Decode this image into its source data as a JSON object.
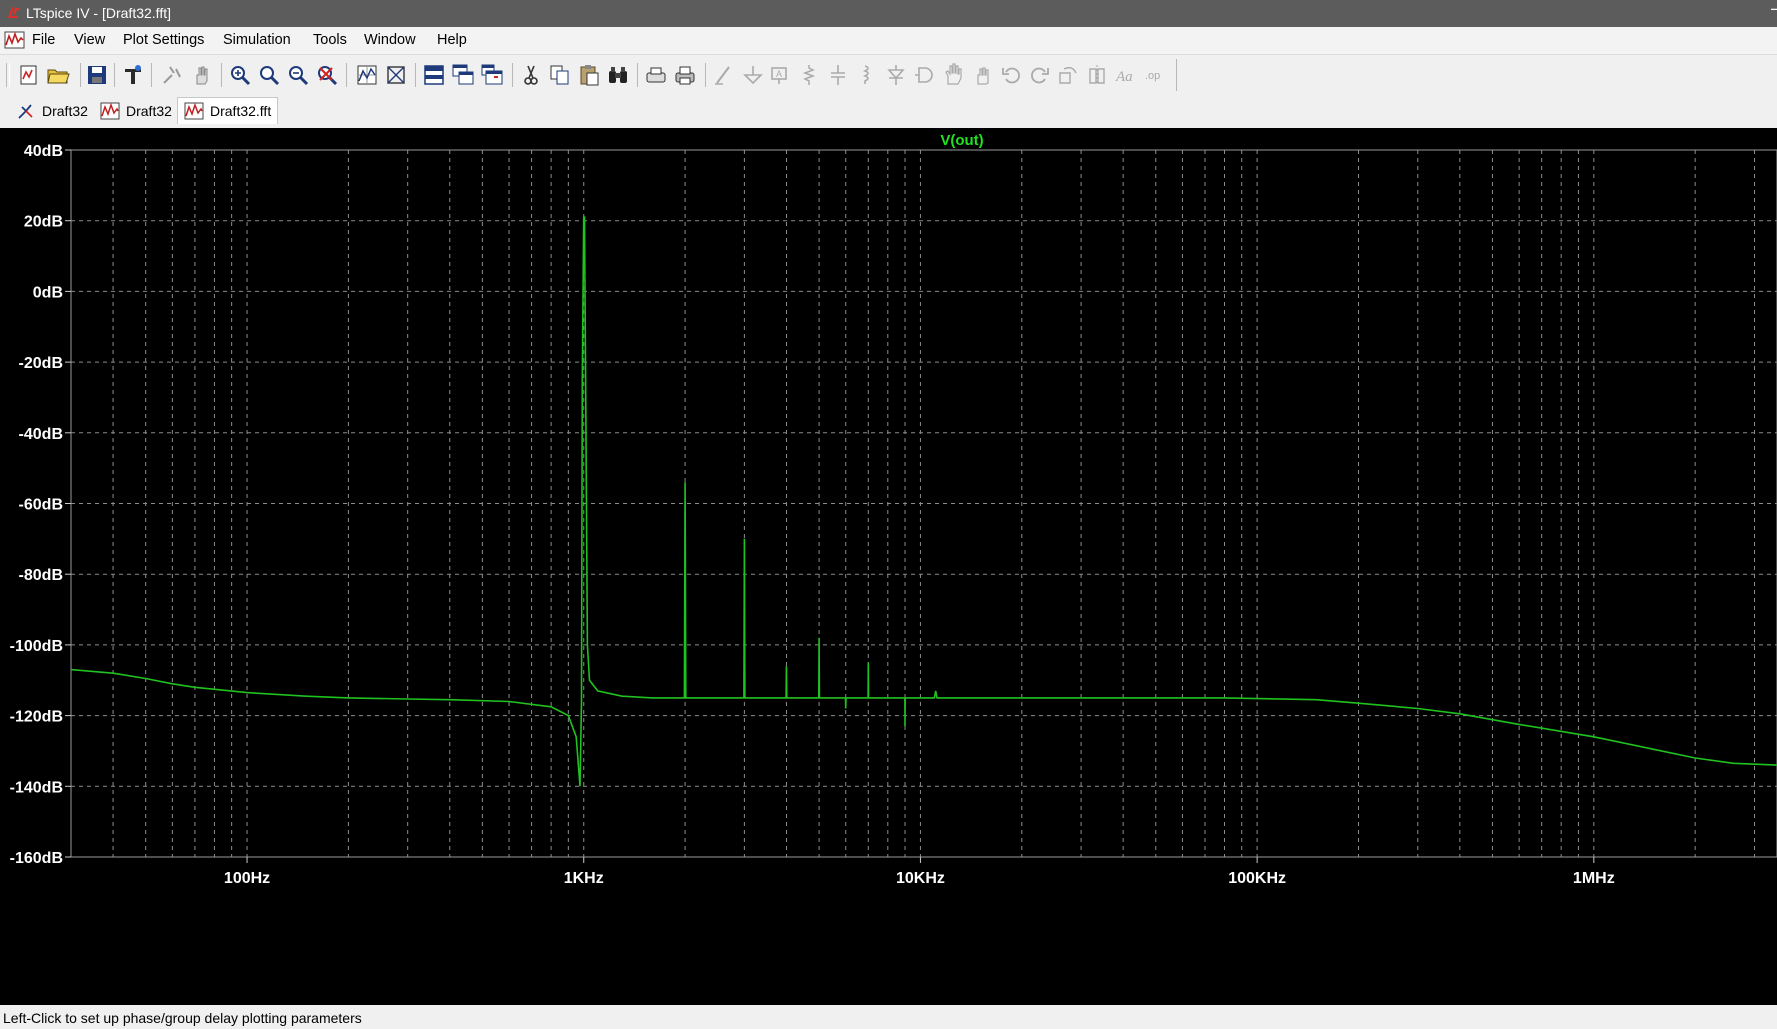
{
  "window": {
    "title": "LTspice IV - [Draft32.fft]",
    "close_glyph": "–"
  },
  "menu": {
    "items": [
      "File",
      "View",
      "Plot Settings",
      "Simulation",
      "Tools",
      "Window",
      "Help"
    ]
  },
  "tabs": [
    {
      "label": "Draft32",
      "icon": "schematic-icon",
      "active": false
    },
    {
      "label": "Draft32",
      "icon": "waveform-icon",
      "active": false
    },
    {
      "label": "Draft32.fft",
      "icon": "waveform-icon",
      "active": true
    }
  ],
  "status": {
    "text": "Left-Click to set up phase/group delay plotting parameters"
  },
  "colors": {
    "trace": "#1fc21f",
    "plot_bg": "#000000",
    "grid": "#8c8c8c"
  },
  "chart_data": {
    "type": "line",
    "title": "V(out)",
    "x_scale": "log",
    "xlim_hz": [
      30,
      3500000
    ],
    "ylim_db": [
      -160,
      40
    ],
    "grid": true,
    "y_ticks": [
      {
        "value": 40,
        "label": "40dB"
      },
      {
        "value": 20,
        "label": "20dB"
      },
      {
        "value": 0,
        "label": "0dB"
      },
      {
        "value": -20,
        "label": "-20dB"
      },
      {
        "value": -40,
        "label": "-40dB"
      },
      {
        "value": -60,
        "label": "-60dB"
      },
      {
        "value": -80,
        "label": "-80dB"
      },
      {
        "value": -100,
        "label": "-100dB"
      },
      {
        "value": -120,
        "label": "-120dB"
      },
      {
        "value": -140,
        "label": "-140dB"
      },
      {
        "value": -160,
        "label": "-160dB"
      }
    ],
    "x_ticks": [
      {
        "value": 100,
        "label": "100Hz"
      },
      {
        "value": 1000,
        "label": "1KHz"
      },
      {
        "value": 10000,
        "label": "10KHz"
      },
      {
        "value": 100000,
        "label": "100KHz"
      },
      {
        "value": 1000000,
        "label": "1MHz"
      }
    ],
    "series": [
      {
        "name": "V(out)",
        "points": [
          [
            30,
            -107
          ],
          [
            40,
            -108
          ],
          [
            50,
            -109.5
          ],
          [
            60,
            -111
          ],
          [
            70,
            -112
          ],
          [
            100,
            -113.5
          ],
          [
            150,
            -114.5
          ],
          [
            200,
            -115
          ],
          [
            300,
            -115.3
          ],
          [
            400,
            -115.5
          ],
          [
            600,
            -116
          ],
          [
            800,
            -117.5
          ],
          [
            900,
            -120
          ],
          [
            950,
            -126
          ],
          [
            975,
            -140
          ],
          [
            985,
            -116
          ],
          [
            990,
            -25
          ],
          [
            1000,
            21
          ],
          [
            1005,
            21
          ],
          [
            1012,
            -20
          ],
          [
            1025,
            -100
          ],
          [
            1040,
            -110
          ],
          [
            1100,
            -113
          ],
          [
            1300,
            -114.5
          ],
          [
            1600,
            -115
          ],
          [
            1990,
            -115
          ],
          [
            2000,
            -54
          ],
          [
            2010,
            -115
          ],
          [
            2990,
            -115
          ],
          [
            3000,
            -70
          ],
          [
            3010,
            -115
          ],
          [
            3990,
            -115
          ],
          [
            4000,
            -106
          ],
          [
            4010,
            -115
          ],
          [
            4990,
            -115
          ],
          [
            5000,
            -98
          ],
          [
            5010,
            -115
          ],
          [
            5990,
            -115
          ],
          [
            6000,
            -118
          ],
          [
            6010,
            -115
          ],
          [
            6990,
            -115
          ],
          [
            7000,
            -105
          ],
          [
            7010,
            -115
          ],
          [
            8990,
            -115
          ],
          [
            9000,
            -123
          ],
          [
            9010,
            -115
          ],
          [
            10000,
            -115
          ],
          [
            11000,
            -115
          ],
          [
            11100,
            -113
          ],
          [
            11200,
            -115
          ],
          [
            30000,
            -115
          ],
          [
            80000,
            -115
          ],
          [
            150000,
            -115.5
          ],
          [
            200000,
            -116.5
          ],
          [
            300000,
            -118
          ],
          [
            400000,
            -119.5
          ],
          [
            600000,
            -122.5
          ],
          [
            1000000,
            -126
          ],
          [
            1500000,
            -129.5
          ],
          [
            2000000,
            -132
          ],
          [
            2600000,
            -133.5
          ],
          [
            3500000,
            -134
          ]
        ]
      }
    ]
  }
}
